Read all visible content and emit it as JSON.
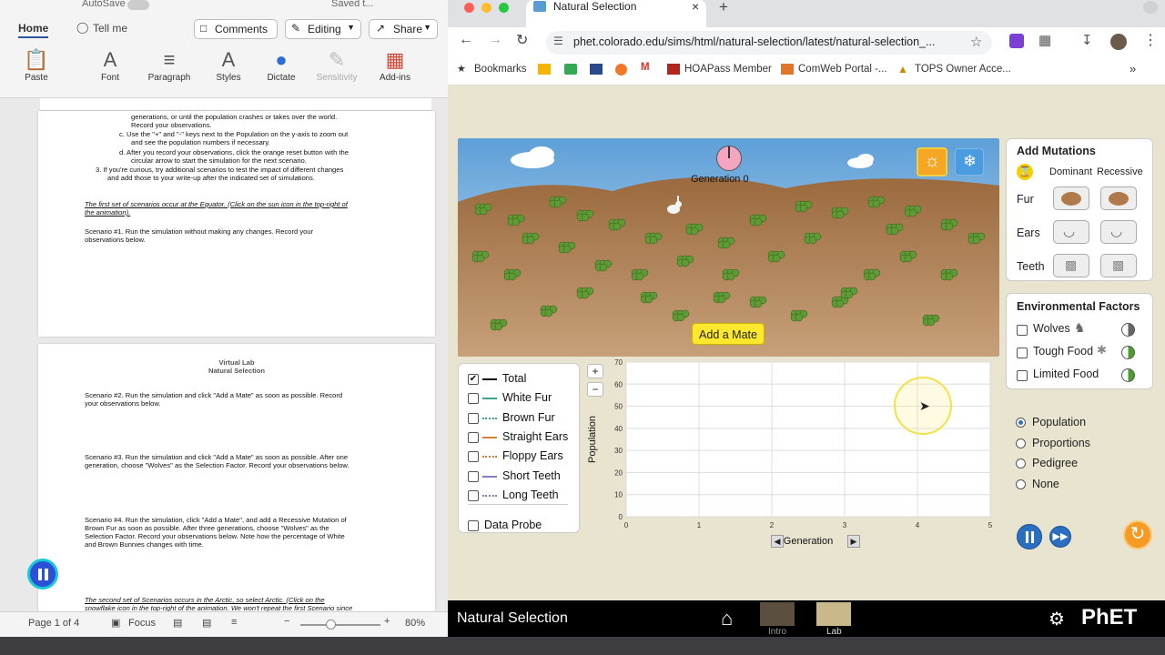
{
  "word": {
    "autosave": "AutoSave",
    "saved": "Saved t...",
    "tabs": {
      "home": "Home",
      "tell_me": "Tell me"
    },
    "buttons": {
      "comments": "Comments",
      "editing": "Editing",
      "share": "Share"
    },
    "ribbon": [
      "Paste",
      "Font",
      "Paragraph",
      "Styles",
      "Dictate",
      "Sensitivity",
      "Add-ins"
    ],
    "page1_lines": [
      "generations, or until the population crashes or takes over the world.",
      "Record your observations.",
      "c.   Use the \"+\" and \"-\" keys next to the Population on the y-axis to zoom out",
      "and see the population numbers if necessary.",
      "d.   After you record your observations, click the orange reset button with the",
      "circular arrow to start the simulation for the next scenario.",
      "3.  If you're curious, try additional scenarios to test the impact of different changes",
      "and add those to your write-up after the indicated set of simulations.",
      "The first set of scenarios occur at the Equator. (Click on the sun icon in the top-right of",
      "the animation).",
      "Scenario #1. Run the simulation without making any changes. Record your",
      "observations below."
    ],
    "page2_title1": "Virtual Lab",
    "page2_title2": "Natural Selection",
    "page2_lines": [
      "Scenario #2. Run the simulation and click \"Add a Mate\" as soon as possible. Record",
      "your observations below.",
      "Scenario #3. Run the simulation and click \"Add a Mate\" as soon as possible. After one",
      "generation, choose \"Wolves\" as the Selection Factor. Record your observations below.",
      "Scenario #4. Run the simulation, click \"Add a Mate\", and add a Recessive Mutation of",
      "Brown Fur as soon as possible. After three generations, choose \"Wolves\" as the",
      "Selection Factor. Record your observations below. Note how the percentage of White",
      "and Brown Bunnies changes with time.",
      "The second set of Scenarios occurs in the Arctic, so select Arctic. (Click on the",
      "snowflake icon in the top-right of the animation. We won't repeat the first Scenario since"
    ],
    "status": {
      "page": "Page 1 of 4",
      "focus": "Focus",
      "zoom": "80%"
    }
  },
  "browser": {
    "tab_title": "Natural Selection",
    "url": "phet.colorado.edu/sims/html/natural-selection/latest/natural-selection_...",
    "bookmarks": [
      "Bookmarks",
      "HOAPass Member",
      "ComWeb Portal -...",
      "TOPS Owner Acce..."
    ]
  },
  "sim": {
    "generation_label": "Generation 0",
    "add_mate": "Add a Mate",
    "legend": [
      {
        "label": "Total",
        "checked": true,
        "color": "#000000",
        "style": "solid"
      },
      {
        "label": "White Fur",
        "checked": false,
        "color": "#3aa58a",
        "style": "solid"
      },
      {
        "label": "Brown Fur",
        "checked": false,
        "color": "#3aa58a",
        "style": "dotted"
      },
      {
        "label": "Straight Ears",
        "checked": false,
        "color": "#d2813a",
        "style": "solid"
      },
      {
        "label": "Floppy Ears",
        "checked": false,
        "color": "#d2813a",
        "style": "dotted"
      },
      {
        "label": "Short Teeth",
        "checked": false,
        "color": "#8c79c2",
        "style": "solid"
      },
      {
        "label": "Long Teeth",
        "checked": false,
        "color": "#8c79c2",
        "style": "dotted"
      }
    ],
    "data_probe": "Data Probe",
    "zoom_in": "+",
    "zoom_out": "−",
    "mutations": {
      "title": "Add Mutations",
      "dominant": "Dominant",
      "recessive": "Recessive",
      "rows": [
        "Fur",
        "Ears",
        "Teeth"
      ]
    },
    "env": {
      "title": "Environmental Factors",
      "items": [
        "Wolves",
        "Tough Food",
        "Limited Food"
      ]
    },
    "views": [
      {
        "label": "Population",
        "selected": true
      },
      {
        "label": "Proportions",
        "selected": false
      },
      {
        "label": "Pedigree",
        "selected": false
      },
      {
        "label": "None",
        "selected": false
      }
    ],
    "footer": {
      "title": "Natural Selection",
      "screens": [
        "Intro",
        "Lab"
      ],
      "brand": "PhET"
    }
  },
  "chart_data": {
    "type": "line",
    "xlabel": "Generation",
    "ylabel": "Population",
    "xlim": [
      0,
      5
    ],
    "ylim": [
      0,
      70
    ],
    "x_ticks": [
      0,
      1,
      2,
      3,
      4,
      5
    ],
    "y_ticks": [
      0,
      10,
      20,
      30,
      40,
      50,
      60,
      70
    ],
    "series": [],
    "grid": true
  }
}
